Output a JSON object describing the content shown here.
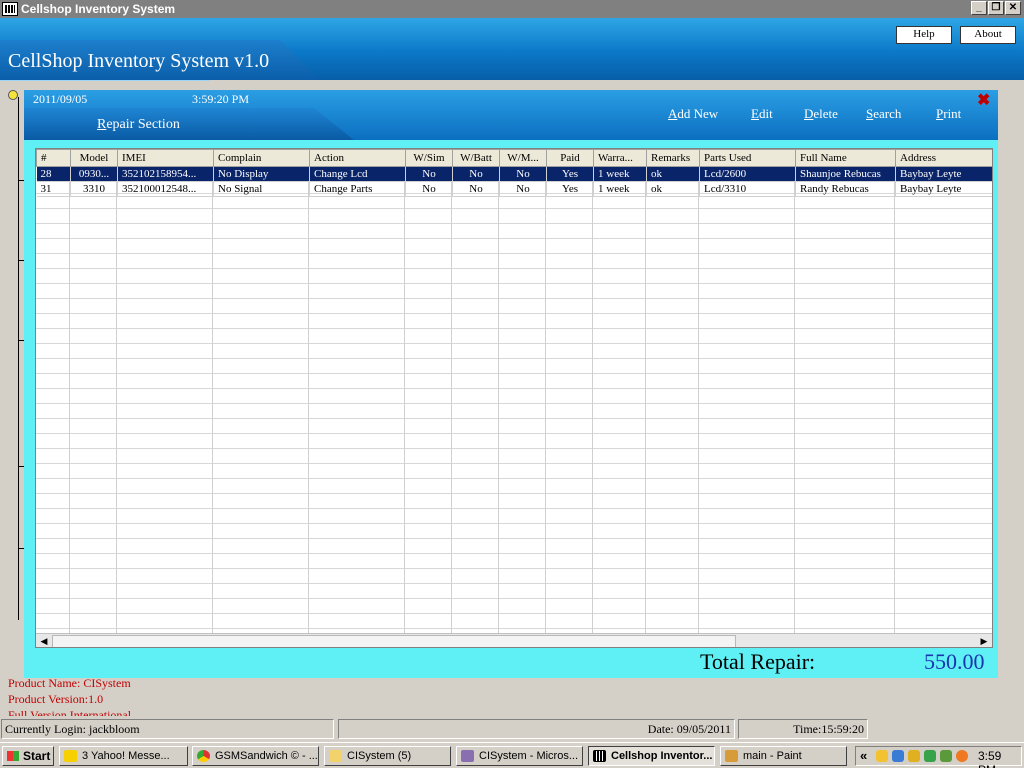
{
  "window": {
    "title": "Cellshop Inventory System"
  },
  "header": {
    "app_title": "CellShop Inventory System v1.0",
    "help_label": "Help",
    "about_label": "About"
  },
  "section": {
    "date": "2011/09/05",
    "time": "3:59:20 PM",
    "title": "Repair Section",
    "close_symbol": "✖",
    "toolbar": {
      "add_new": "Add New",
      "edit": "Edit",
      "delete": "Delete",
      "search": "Search",
      "print": "Print"
    }
  },
  "table": {
    "columns": [
      "#",
      "Model",
      "IMEI",
      "Complain",
      "Action",
      "W/Sim",
      "W/Batt",
      "W/M...",
      "Paid",
      "Warra...",
      "Remarks",
      "Parts Used",
      "Full Name",
      "Address"
    ],
    "rows": [
      [
        "28",
        "0930...",
        "352102158954...",
        "No Display",
        "Change Lcd",
        "No",
        "No",
        "No",
        "Yes",
        "1 week",
        "ok",
        "Lcd/2600",
        "Shaunjoe Rebucas",
        "Baybay Leyte"
      ],
      [
        "31",
        "3310",
        "352100012548...",
        "No Signal",
        "Change Parts",
        "No",
        "No",
        "No",
        "Yes",
        "1 week",
        "ok",
        "Lcd/3310",
        "Randy Rebucas",
        "Baybay Leyte"
      ]
    ]
  },
  "totals": {
    "label": "Total Repair:",
    "value": "550.00"
  },
  "product": {
    "name": "Product Name:   CISystem",
    "version": "Product Version:1.0",
    "license": "Full Version International"
  },
  "status": {
    "login": "Currently Login: jackbloom",
    "date": "Date: 09/05/2011",
    "time": "Time:15:59:20"
  },
  "taskbar": {
    "start": "Start",
    "tasks": [
      "3 Yahoo! Messe...",
      "GSMSandwich © - ...",
      "CISystem (5)",
      "CISystem - Micros...",
      "Cellshop Inventor...",
      "main - Paint"
    ],
    "clock": "3:59 PM",
    "tray_chevron": "«"
  },
  "colors": {
    "banner": "#0b78c8",
    "section_bg": "#5ef0f4",
    "selection": "#0a246a",
    "product_text": "#c00000",
    "total_value": "#1a35b0"
  }
}
